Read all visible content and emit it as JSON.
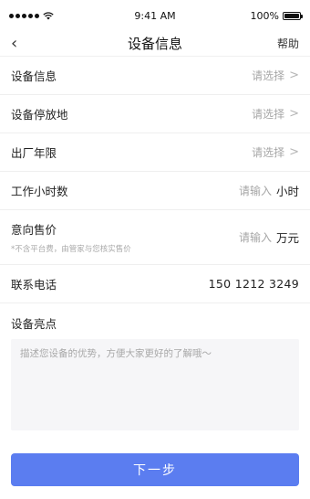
{
  "status_bar": {
    "time": "9:41 AM",
    "battery_percent": "100%"
  },
  "nav": {
    "back_icon": "chevron-left-icon",
    "title": "设备信息",
    "help": "帮助"
  },
  "form": {
    "device_info": {
      "label": "设备信息",
      "value": "请选择"
    },
    "parking_location": {
      "label": "设备停放地",
      "value": "请选择"
    },
    "production_year": {
      "label": "出厂年限",
      "value": "请选择"
    },
    "working_hours": {
      "label": "工作小时数",
      "placeholder": "请输入",
      "unit": "小时"
    },
    "expected_price": {
      "label": "意向售价",
      "sublabel": "*不含平台费，由管家与您核实售价",
      "placeholder": "请输入",
      "unit": "万元"
    },
    "contact_phone": {
      "label": "联系电话",
      "value": "150 1212 3249"
    },
    "highlights": {
      "label": "设备亮点",
      "placeholder": "描述您设备的优势，方便大家更好的了解哦～"
    }
  },
  "next_button": {
    "label": "下一步"
  },
  "colors": {
    "primary": "#5b7df0",
    "placeholder": "#a6a6a6",
    "textarea_bg": "#f6f6f8"
  }
}
